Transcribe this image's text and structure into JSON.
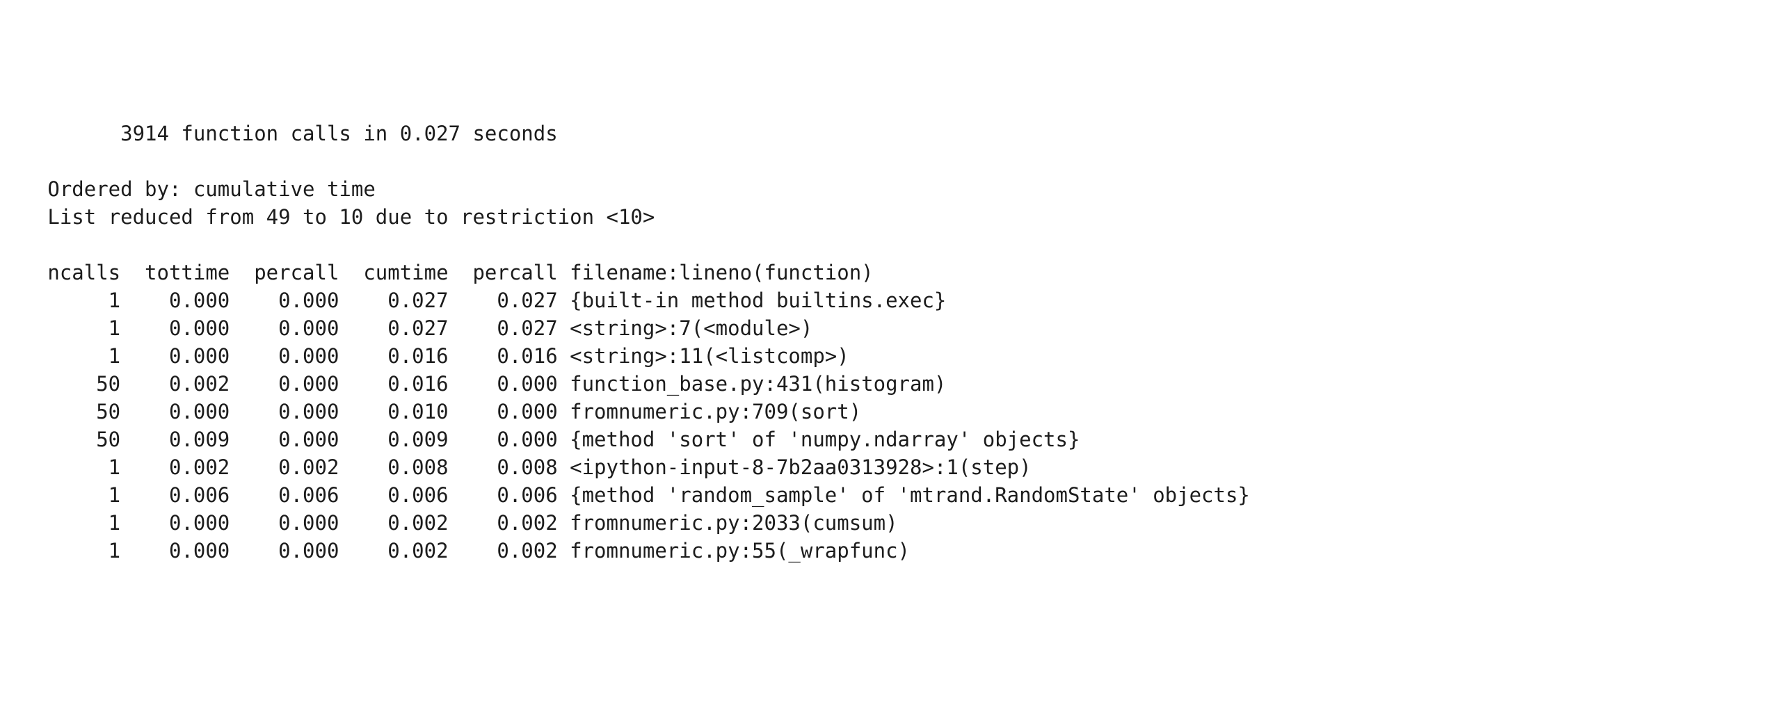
{
  "summary_line": "         3914 function calls in 0.027 seconds",
  "ordered_by": "   Ordered by: cumulative time",
  "list_reduced": "   List reduced from 49 to 10 due to restriction <10>",
  "header": "   ncalls  tottime  percall  cumtime  percall filename:lineno(function)",
  "rows": [
    {
      "ncalls": "1",
      "tottime": "0.000",
      "percall1": "0.000",
      "cumtime": "0.027",
      "percall2": "0.027",
      "filename": "{built-in method builtins.exec}"
    },
    {
      "ncalls": "1",
      "tottime": "0.000",
      "percall1": "0.000",
      "cumtime": "0.027",
      "percall2": "0.027",
      "filename": "<string>:7(<module>)"
    },
    {
      "ncalls": "1",
      "tottime": "0.000",
      "percall1": "0.000",
      "cumtime": "0.016",
      "percall2": "0.016",
      "filename": "<string>:11(<listcomp>)"
    },
    {
      "ncalls": "50",
      "tottime": "0.002",
      "percall1": "0.000",
      "cumtime": "0.016",
      "percall2": "0.000",
      "filename": "function_base.py:431(histogram)"
    },
    {
      "ncalls": "50",
      "tottime": "0.000",
      "percall1": "0.000",
      "cumtime": "0.010",
      "percall2": "0.000",
      "filename": "fromnumeric.py:709(sort)"
    },
    {
      "ncalls": "50",
      "tottime": "0.009",
      "percall1": "0.000",
      "cumtime": "0.009",
      "percall2": "0.000",
      "filename": "{method 'sort' of 'numpy.ndarray' objects}"
    },
    {
      "ncalls": "1",
      "tottime": "0.002",
      "percall1": "0.002",
      "cumtime": "0.008",
      "percall2": "0.008",
      "filename": "<ipython-input-8-7b2aa0313928>:1(step)"
    },
    {
      "ncalls": "1",
      "tottime": "0.006",
      "percall1": "0.006",
      "cumtime": "0.006",
      "percall2": "0.006",
      "filename": "{method 'random_sample' of 'mtrand.RandomState' objects}"
    },
    {
      "ncalls": "1",
      "tottime": "0.000",
      "percall1": "0.000",
      "cumtime": "0.002",
      "percall2": "0.002",
      "filename": "fromnumeric.py:2033(cumsum)"
    },
    {
      "ncalls": "1",
      "tottime": "0.000",
      "percall1": "0.000",
      "cumtime": "0.002",
      "percall2": "0.002",
      "filename": "fromnumeric.py:55(_wrapfunc)"
    }
  ]
}
